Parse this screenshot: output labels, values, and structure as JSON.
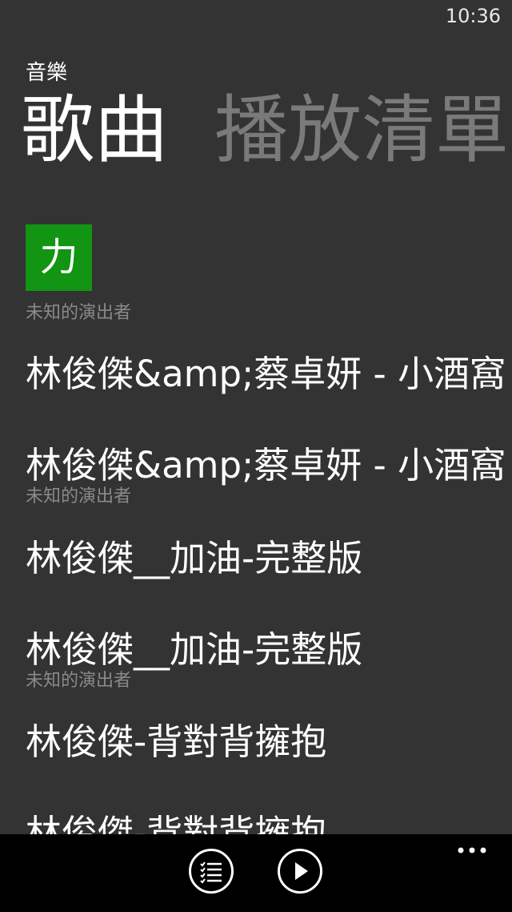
{
  "status": {
    "time": "10:36"
  },
  "app": {
    "title": "音樂"
  },
  "pivot": {
    "active": "歌曲",
    "next": "播放清單"
  },
  "jump_tile": {
    "letter": "力"
  },
  "list": {
    "subtitle_0": "未知的演出者",
    "title_1": "林俊傑&amp;蔡卓妍 - 小酒窩",
    "title_2": "林俊傑&amp;蔡卓妍 - 小酒窩",
    "subtitle_2": "未知的演出者",
    "title_3": "林俊傑__加油-完整版",
    "title_4": "林俊傑__加油-完整版",
    "subtitle_4": "未知的演出者",
    "title_5": "林俊傑-背對背擁抱",
    "title_6": "林俊傑-背對背擁抱"
  },
  "appbar": {
    "buttons": [
      {
        "icon": "list-icon"
      },
      {
        "icon": "play-icon"
      }
    ],
    "more": "more-icon"
  },
  "colors": {
    "background": "#333333",
    "accent": "#129512",
    "appbar": "#000000",
    "inactive": "#7a7a7a",
    "subtitle": "#8a8a8a"
  }
}
